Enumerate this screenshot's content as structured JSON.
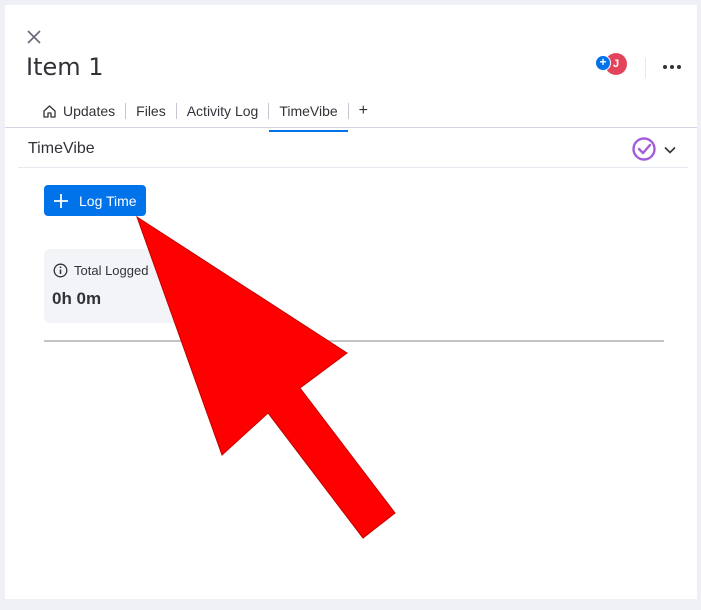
{
  "item": {
    "title": "Item 1"
  },
  "header": {
    "avatar_initial": "J",
    "add_person_icon": "plus-icon"
  },
  "tabs": [
    {
      "label": "Updates",
      "icon": "home-icon"
    },
    {
      "label": "Files"
    },
    {
      "label": "Activity Log"
    },
    {
      "label": "TimeVibe",
      "active": true
    }
  ],
  "tab_add_label": "+",
  "app": {
    "name": "TimeVibe",
    "logo_color": "#a25ddc"
  },
  "log_button": {
    "label": "Log Time"
  },
  "summary": {
    "label": "Total Logged",
    "value": "0h 0m"
  },
  "colors": {
    "primary": "#0073ea",
    "avatar": "#e2445c",
    "arrow": "#ff0000"
  }
}
